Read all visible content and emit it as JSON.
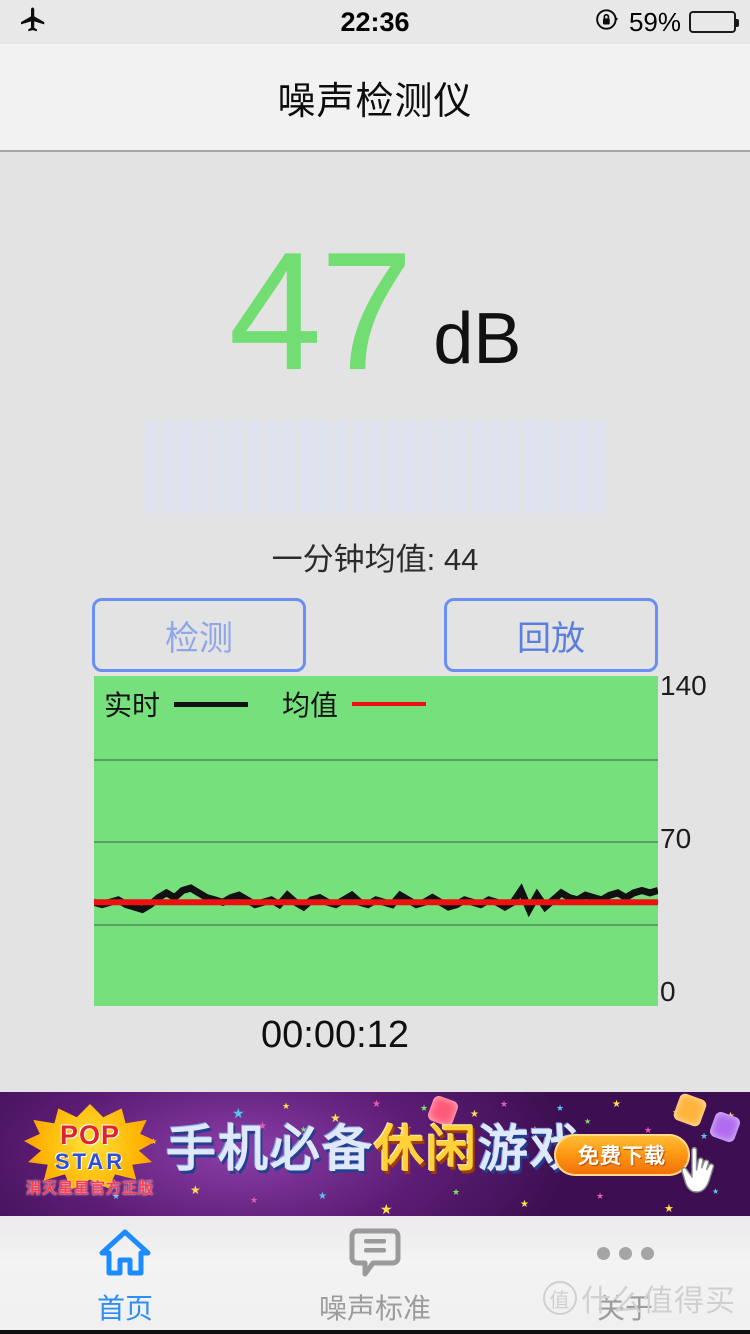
{
  "status_bar": {
    "airplane_icon": "airplane-mode-icon",
    "time": "22:36",
    "rotation_lock_icon": "rotation-lock-icon",
    "battery_percent": "59%",
    "battery_level": 59
  },
  "nav": {
    "title": "噪声检测仪"
  },
  "reading": {
    "value": "47",
    "unit": "dB",
    "color": "#72dd73",
    "meter_segments": 27
  },
  "average": {
    "text": "一分钟均值: 44",
    "value": 44
  },
  "buttons": {
    "detect": "检测",
    "replay": "回放"
  },
  "chart_data": {
    "type": "line",
    "title": "",
    "xlabel": "",
    "ylabel": "",
    "ylim": [
      0,
      140
    ],
    "yticks": [
      0,
      70,
      140
    ],
    "ytick_labels": [
      "0",
      "70",
      "140"
    ],
    "gridlines": [
      35,
      70,
      105
    ],
    "grid": true,
    "legend_position": "top-left",
    "plot_background": "#76e07c",
    "series": [
      {
        "name": "实时",
        "color": "#111111",
        "values": [
          44,
          43,
          44,
          45,
          43,
          42,
          41,
          43,
          46,
          48,
          46,
          49,
          50,
          48,
          46,
          45,
          44,
          46,
          47,
          45,
          43,
          44,
          45,
          43,
          47,
          44,
          42,
          45,
          46,
          44,
          43,
          45,
          47,
          44,
          43,
          45,
          44,
          43,
          47,
          45,
          43,
          44,
          46,
          44,
          42,
          43,
          45,
          44,
          43,
          45,
          44,
          42,
          44,
          49,
          41,
          47,
          42,
          45,
          48,
          46,
          45,
          47,
          46,
          45,
          47,
          48,
          46,
          48,
          49,
          48,
          49
        ]
      },
      {
        "name": "均值",
        "color": "#ee1111",
        "values": [
          44,
          44,
          44,
          44,
          44,
          44,
          44,
          44,
          44,
          44,
          44,
          44,
          44,
          44,
          44,
          44,
          44,
          44,
          44,
          44,
          44,
          44,
          44,
          44,
          44,
          44,
          44,
          44,
          44,
          44,
          44,
          44,
          44,
          44,
          44,
          44,
          44,
          44,
          44,
          44,
          44,
          44,
          44,
          44,
          44,
          44,
          44,
          44,
          44,
          44,
          44,
          44,
          44,
          44,
          44,
          44,
          44,
          44,
          44,
          44,
          44,
          44,
          44,
          44,
          44,
          44,
          44,
          44,
          44,
          44,
          44
        ]
      }
    ]
  },
  "timer": "00:00:12",
  "ad": {
    "logo_pop": "POP",
    "logo_star": "STAR",
    "logo_sub": "消灭星星官方正版",
    "headline_1": "手机必备",
    "headline_2": "休闲",
    "headline_3": "游戏",
    "cta": "免费下载"
  },
  "tabs": [
    {
      "label": "首页",
      "icon": "home-icon",
      "active": true
    },
    {
      "label": "噪声标准",
      "icon": "speech-bubble-icon",
      "active": false
    },
    {
      "label": "关于",
      "icon": "more-dots-icon",
      "active": false
    }
  ],
  "watermark": {
    "mark": "值",
    "text": "什么值得买"
  }
}
